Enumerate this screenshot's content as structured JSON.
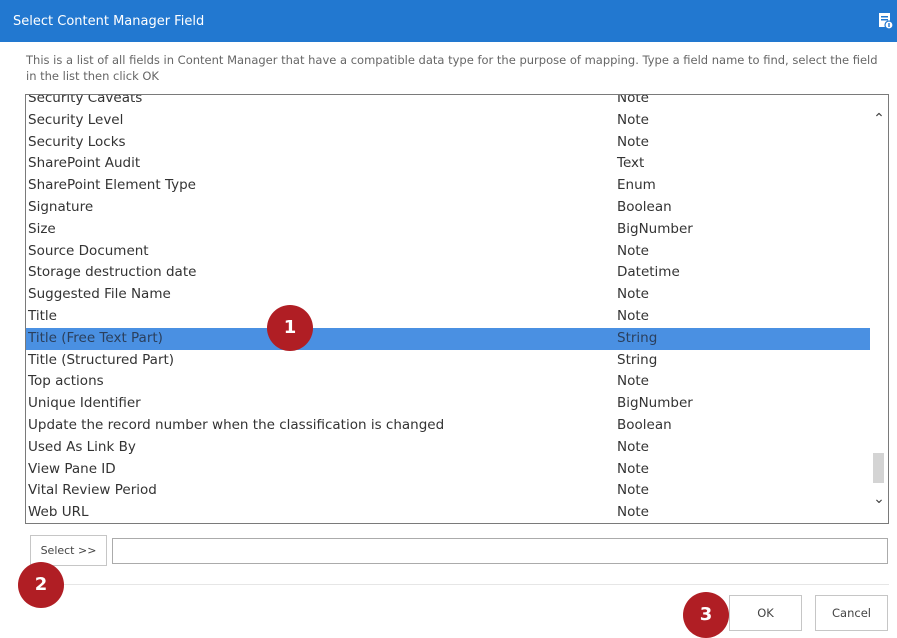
{
  "dialog": {
    "title": "Select Content Manager Field",
    "description": "This is a list of all fields in Content Manager that have a compatible data type for the purpose of mapping. Type a field name to find, select the field in the list then click OK"
  },
  "fields": [
    {
      "name": "Security Caveats",
      "type": "Note"
    },
    {
      "name": "Security Level",
      "type": "Note"
    },
    {
      "name": "Security Locks",
      "type": "Note"
    },
    {
      "name": "SharePoint Audit",
      "type": "Text"
    },
    {
      "name": "SharePoint Element Type",
      "type": "Enum"
    },
    {
      "name": "Signature",
      "type": "Boolean"
    },
    {
      "name": "Size",
      "type": "BigNumber"
    },
    {
      "name": "Source Document",
      "type": "Note"
    },
    {
      "name": "Storage destruction date",
      "type": "Datetime"
    },
    {
      "name": "Suggested File Name",
      "type": "Note"
    },
    {
      "name": "Title",
      "type": "Note"
    },
    {
      "name": "Title (Free Text Part)",
      "type": "String"
    },
    {
      "name": "Title (Structured Part)",
      "type": "String"
    },
    {
      "name": "Top actions",
      "type": "Note"
    },
    {
      "name": "Unique Identifier",
      "type": "BigNumber"
    },
    {
      "name": "Update the record number when the classification is changed",
      "type": "Boolean"
    },
    {
      "name": "Used As Link By",
      "type": "Note"
    },
    {
      "name": "View Pane ID",
      "type": "Note"
    },
    {
      "name": "Vital Review Period",
      "type": "Note"
    },
    {
      "name": "Web URL",
      "type": "Note"
    }
  ],
  "selected_field": "Title (Free Text Part)",
  "buttons": {
    "select_label": "Select >>",
    "ok_label": "OK",
    "cancel_label": "Cancel"
  },
  "search": {
    "value": ""
  },
  "markers": {
    "one": "1",
    "two": "2",
    "three": "3"
  },
  "colors": {
    "title_bar": "#2278d0",
    "selection": "#4a90e2",
    "marker": "#b01e24"
  }
}
